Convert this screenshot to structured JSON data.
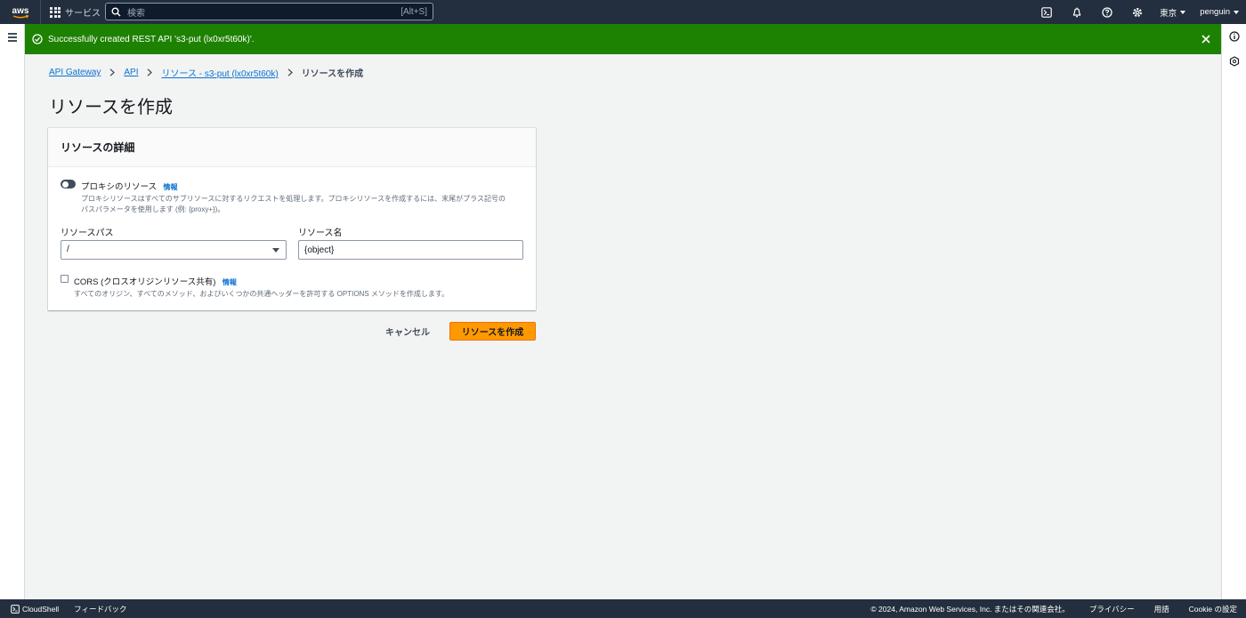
{
  "topnav": {
    "logo_text": "aws",
    "services_label": "サービス",
    "search_placeholder": "検索",
    "search_shortcut": "[Alt+S]",
    "region": "東京",
    "user": "penguin"
  },
  "flash": {
    "message": "Successfully created REST API 's3-put (lx0xr5t60k)'."
  },
  "breadcrumb": {
    "items": [
      "API Gateway",
      "API",
      "リソース - s3-put (lx0xr5t60k)"
    ],
    "current": "リソースを作成"
  },
  "page": {
    "title": "リソースを作成"
  },
  "form": {
    "header": "リソースの詳細",
    "proxy_label": "プロキシのリソース",
    "info_label": "情報",
    "proxy_desc_line1": "プロキシリソースはすべてのサブリソースに対するリクエストを処理します。プロキシリソースを作成するには、末尾がプラス記号の",
    "proxy_desc_line2": "パスパラメータを使用します (例: {proxy+})。",
    "path_label": "リソースパス",
    "path_value": "/",
    "name_label": "リソース名",
    "name_value": "{object}",
    "cors_label": "CORS (クロスオリジンリソース共有)",
    "cors_desc": "すべてのオリジン、すべてのメソッド、およびいくつかの共通ヘッダーを許可する OPTIONS メソッドを作成します。"
  },
  "actions": {
    "cancel": "キャンセル",
    "submit": "リソースを作成"
  },
  "footer": {
    "cloudshell": "CloudShell",
    "feedback": "フィードバック",
    "copyright": "© 2024, Amazon Web Services, Inc. またはその関連会社。",
    "privacy": "プライバシー",
    "terms": "用語",
    "cookie": "Cookie の設定"
  },
  "colors": {
    "nav_bg": "#232f3e",
    "flash_bg": "#1d8102",
    "primary": "#ff9900",
    "link": "#0972d3"
  }
}
